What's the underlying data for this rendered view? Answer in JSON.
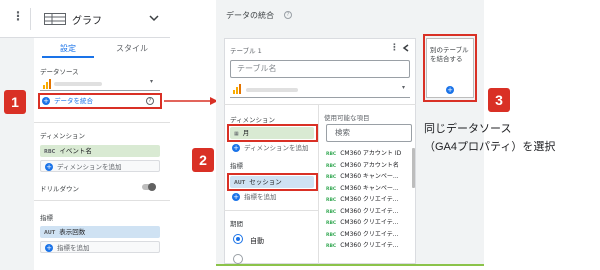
{
  "left_panel": {
    "kebab": "⋮",
    "chart_title": "グラフ",
    "tabs": {
      "setup": "設定",
      "style": "スタイル"
    },
    "data_source_header": "データソース",
    "blend_data_link": "データを統合",
    "help_glyph": "?",
    "dimension_header": "ディメンション",
    "dimension_chip_type": "RBC",
    "dimension_chip": "イベント名",
    "add_dimension": "ディメンションを追加",
    "drilldown_label": "ドリルダウン",
    "metric_header": "指標",
    "metric_chip_type": "AUT",
    "metric_chip": "表示回数",
    "add_metric": "指標を追加"
  },
  "blend_panel": {
    "title": "データの統合",
    "help_glyph": "?",
    "table_label": "テーブル 1",
    "table_name_placeholder": "テーブル名",
    "dimension_header": "ディメンション",
    "dimension_chip_type": "▦",
    "dimension_chip": "月",
    "add_dimension": "ディメンションを追加",
    "metric_header": "指標",
    "metric_chip_type": "AUT",
    "metric_chip": "セッション",
    "add_metric": "指標を追加",
    "period_header": "期間",
    "period_option": "自動",
    "available_fields_header": "使用可能な項目",
    "search_placeholder": "検索",
    "fields": [
      {
        "type": "RBC",
        "label": "CM360 アカウント ID"
      },
      {
        "type": "RBC",
        "label": "CM360 アカウント名"
      },
      {
        "type": "RBC",
        "label": "CM360 キャンペー..."
      },
      {
        "type": "RBC",
        "label": "CM360 キャンペー..."
      },
      {
        "type": "RBC",
        "label": "CM360 クリエイテ..."
      },
      {
        "type": "RBC",
        "label": "CM360 クリエイテ..."
      },
      {
        "type": "RBC",
        "label": "CM360 クリエイテ..."
      },
      {
        "type": "RBC",
        "label": "CM360 クリエイテ..."
      },
      {
        "type": "RBC",
        "label": "CM360 クリエイテ..."
      }
    ],
    "join_table_button": "別のテーブルを結合する"
  },
  "annotations": {
    "badge1": "1",
    "badge2": "2",
    "badge3": "3",
    "callout_line1": "同じデータソース",
    "callout_line2": "（GA4プロパティ）を選択"
  },
  "colors": {
    "highlight_red": "#d93025",
    "accent_blue": "#1a73e8",
    "dimension_green": "#d9ead3",
    "metric_blue": "#cfe2f3"
  }
}
